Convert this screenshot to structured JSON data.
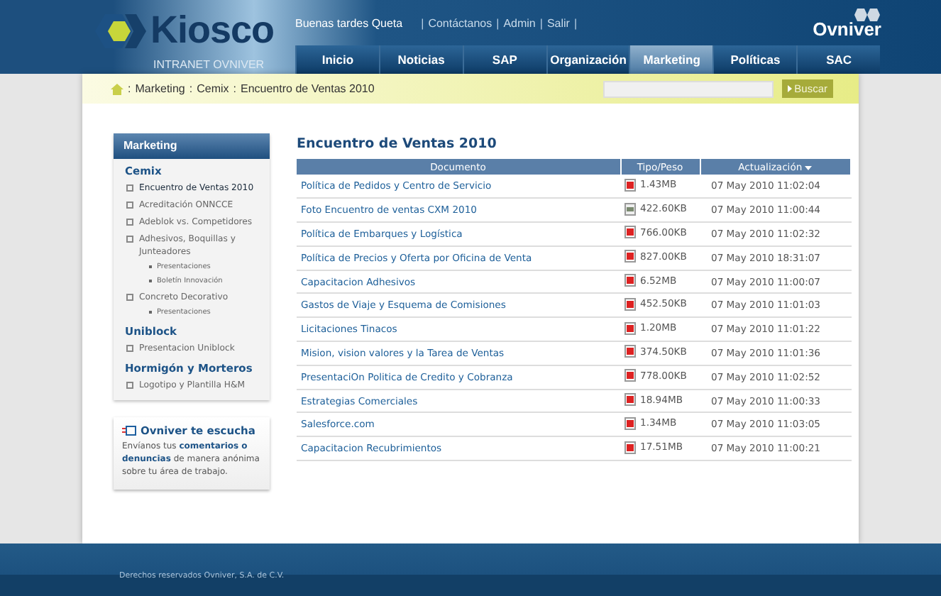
{
  "header": {
    "logo": "Kiosco",
    "logo_subtitle": "INTRANET OVNIVER",
    "greeting": "Buenas tardes Queta",
    "links": [
      "Contáctanos",
      "Admin",
      "Salir"
    ],
    "link_separator": "|",
    "brand": "Ovniver"
  },
  "nav": [
    {
      "label": "Inicio",
      "selected": false
    },
    {
      "label": "Noticias",
      "selected": false
    },
    {
      "label": "SAP",
      "selected": false
    },
    {
      "label": "Organización",
      "selected": false
    },
    {
      "label": "Marketing",
      "selected": true
    },
    {
      "label": "Políticas",
      "selected": false
    },
    {
      "label": "SAC",
      "selected": false
    }
  ],
  "breadcrumb": [
    "Marketing",
    "Cemix",
    "Encuentro de Ventas 2010"
  ],
  "breadcrumb_separator": ":",
  "search": {
    "button": "Buscar"
  },
  "sidebar": {
    "title": "Marketing",
    "groups": [
      {
        "title": "Cemix",
        "items": [
          {
            "label": "Encuentro de Ventas 2010",
            "selected": true
          },
          {
            "label": "Acreditación ONNCCE",
            "selected": false
          },
          {
            "label": "Adeblok vs. Competidores",
            "selected": false
          },
          {
            "label": "Adhesivos, Boquillas y Junteadores",
            "selected": false,
            "children": [
              {
                "label": "Presentaciones"
              },
              {
                "label": "Boletín Innovación"
              }
            ]
          },
          {
            "label": "Concreto Decorativo",
            "selected": false,
            "children": [
              {
                "label": "Presentaciones"
              }
            ]
          }
        ]
      },
      {
        "title": "Uniblock",
        "items": [
          {
            "label": "Presentacion Uniblock",
            "selected": false
          }
        ]
      },
      {
        "title": "Hormigón y Morteros",
        "items": [
          {
            "label": "Logotipo y Plantilla H&M",
            "selected": false
          }
        ]
      }
    ]
  },
  "feedback": {
    "title": "Ovniver te escucha",
    "text": "Envíanos tus **comentarios o denuncias** de manera anónima sobre tu área de trabajo."
  },
  "content": {
    "title": "Encuentro de Ventas 2010",
    "columns": [
      "Documento",
      "Tipo/Peso",
      "Actualización"
    ],
    "rows": [
      {
        "name": "Política de Pedidos y Centro de Servicio",
        "kind": "pdf",
        "size": "1.43MB",
        "date": "07 May 2010 11:02:04"
      },
      {
        "name": "Foto Encuentro de ventas CXM 2010",
        "kind": "image",
        "size": "422.60KB",
        "date": "07 May 2010 11:00:44"
      },
      {
        "name": "Política de Embarques y Logística",
        "kind": "pdf",
        "size": "766.00KB",
        "date": "07 May 2010 11:02:32"
      },
      {
        "name": "Política de Precios y Oferta por Oficina de Venta",
        "kind": "pdf",
        "size": "827.00KB",
        "date": "07 May 2010 18:31:07"
      },
      {
        "name": "Capacitacion Adhesivos",
        "kind": "pdf",
        "size": "6.52MB",
        "date": "07 May 2010 11:00:07"
      },
      {
        "name": "Gastos de Viaje y Esquema de Comisiones",
        "kind": "pdf",
        "size": "452.50KB",
        "date": "07 May 2010 11:01:03"
      },
      {
        "name": "Licitaciones Tinacos",
        "kind": "pdf",
        "size": "1.20MB",
        "date": "07 May 2010 11:01:22"
      },
      {
        "name": "Mision, vision valores y la Tarea de Ventas",
        "kind": "pdf",
        "size": "374.50KB",
        "date": "07 May 2010 11:01:36"
      },
      {
        "name": "PresentaciOn Politica de Credito y Cobranza",
        "kind": "pdf",
        "size": "778.00KB",
        "date": "07 May 2010 11:02:52"
      },
      {
        "name": "Estrategias Comerciales",
        "kind": "pdf",
        "size": "18.94MB",
        "date": "07 May 2010 11:00:33"
      },
      {
        "name": "Salesforce.com",
        "kind": "pdf",
        "size": "1.34MB",
        "date": "07 May 2010 11:03:05"
      },
      {
        "name": "Capacitacion Recubrimientos",
        "kind": "pdf",
        "size": "17.51MB",
        "date": "07 May 2010 11:00:21"
      }
    ]
  },
  "footer": "Derechos reservados Ovniver, S.A. de C.V."
}
